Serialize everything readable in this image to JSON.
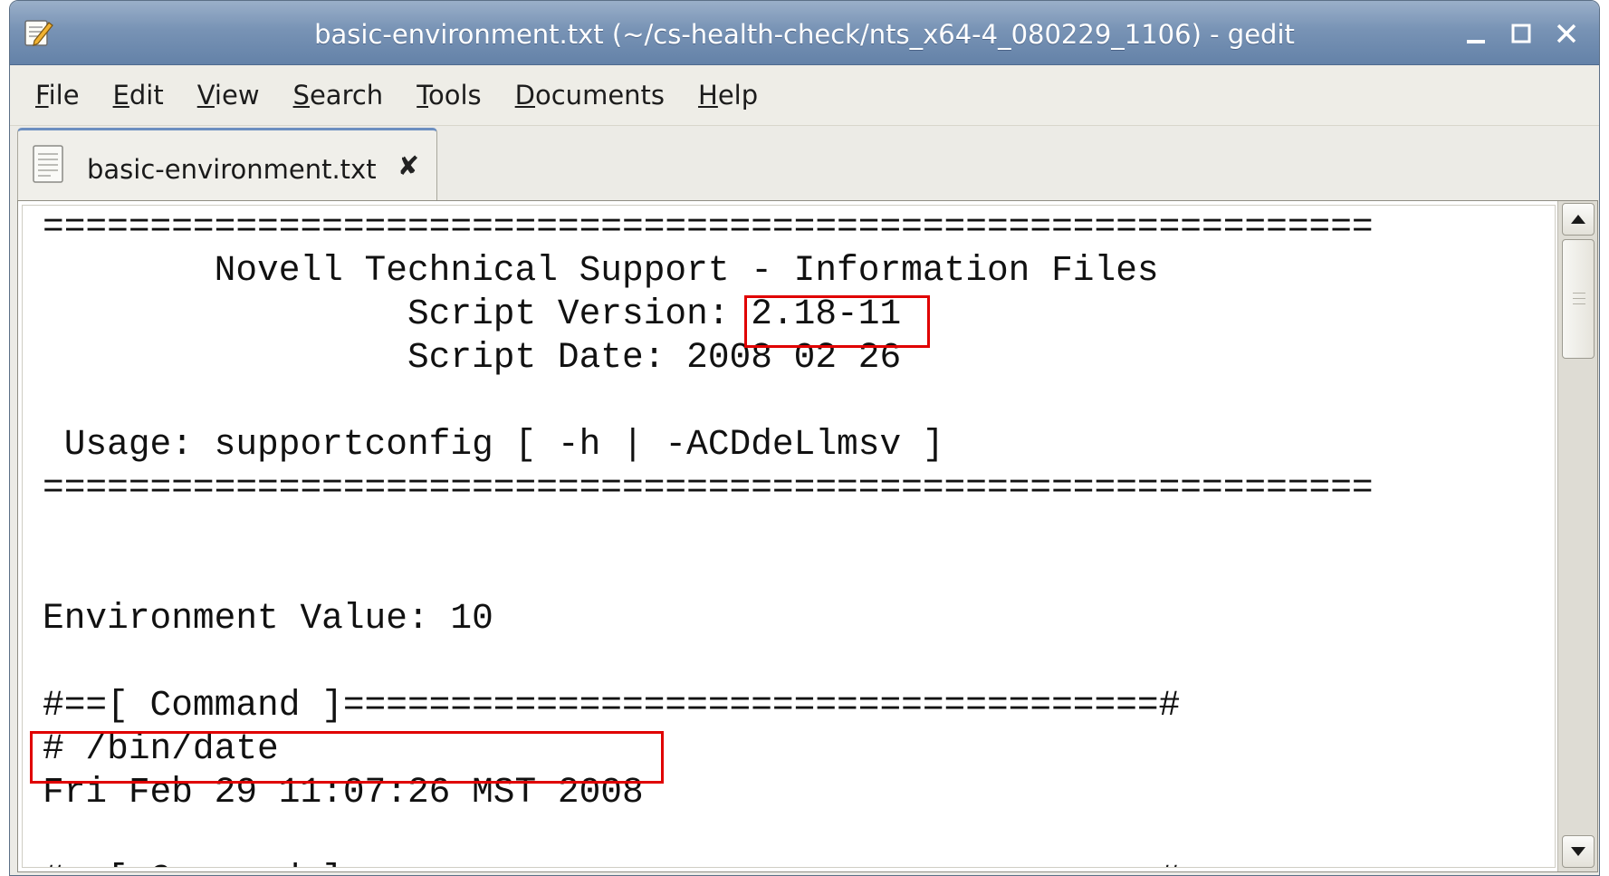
{
  "window": {
    "title": "basic-environment.txt (~/cs-health-check/nts_x64-4_080229_1106) - gedit",
    "app_icon": "text-editor-pencil-icon",
    "buttons": [
      "minimize-icon",
      "maximize-icon",
      "close-icon"
    ]
  },
  "menubar": {
    "items": [
      {
        "mnemonic": "F",
        "rest": "ile"
      },
      {
        "mnemonic": "E",
        "rest": "dit"
      },
      {
        "mnemonic": "V",
        "rest": "iew"
      },
      {
        "mnemonic": "S",
        "rest": "earch"
      },
      {
        "mnemonic": "T",
        "rest": "ools"
      },
      {
        "mnemonic": "D",
        "rest": "ocuments"
      },
      {
        "mnemonic": "H",
        "rest": "elp"
      }
    ]
  },
  "tabs": [
    {
      "label": "basic-environment.txt",
      "icon": "text-document-icon",
      "close": "✘"
    }
  ],
  "editor": {
    "lines": [
      "==============================================================",
      "        Novell Technical Support - Information Files",
      "                 Script Version: 2.18-11",
      "                 Script Date: 2008 02 26",
      "",
      " Usage: supportconfig [ -h | -ACDdeLlmsv ]",
      "==============================================================",
      "",
      "",
      "Environment Value: 10",
      "",
      "#==[ Command ]======================================#",
      "# /bin/date",
      "Fri Feb 29 11:07:26 MST 2008",
      "",
      "#==[ Command ]======================================#"
    ],
    "highlights": [
      {
        "text": "2.18-11",
        "color": "#e00000"
      },
      {
        "text": "Fri Feb 29 11:07:26 MST 2008",
        "color": "#e00000"
      }
    ]
  },
  "scrollbar": {
    "up": "scroll-up-arrow-icon",
    "down": "scroll-down-arrow-icon",
    "position": 0
  }
}
